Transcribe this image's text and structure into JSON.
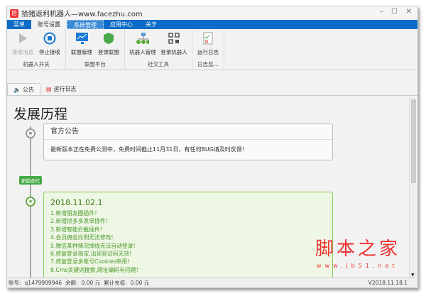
{
  "window": {
    "title": "拾猪返利机器人—www.facezhu.com",
    "minimize": "–",
    "maximize": "☐",
    "close": "✕"
  },
  "menu": [
    "菜单",
    "账号设置",
    "系统管理",
    "应用中心",
    "关于"
  ],
  "ribbon": {
    "groups": [
      {
        "label": "机器人开关",
        "buttons": [
          "接收消息",
          "停止接收"
        ]
      },
      {
        "label": "联盟平台",
        "buttons": [
          "联盟管理",
          "登录联盟"
        ]
      },
      {
        "label": "社交工具",
        "buttons": [
          "机器人管理",
          "登录机器人"
        ]
      },
      {
        "label": "日志监...",
        "buttons": [
          "运行日志"
        ]
      }
    ]
  },
  "tabs": [
    "公告",
    "运行日志"
  ],
  "page_title": "发展历程",
  "notice": {
    "title": "官方公告",
    "body": "最新版本正在免费公测中，免费时间截止11月31日，有任何BUG请及时反馈！"
  },
  "badge": "新版迭代",
  "release": {
    "version": "2018.11.02.1",
    "items": [
      "1.新增朋友圈插件！",
      "2.新增拼多多发单插件！",
      "3.新增智能拦截插件！",
      "4.会员佣金比例无法修改!",
      "5.微信某种情况掉线无法自动登录!",
      "6.修复登录淘宝,出现验证码无效!",
      "7.修复登录多账号Cookies串用!",
      "8.Cms关键词搜索,网址编码有问题!"
    ]
  },
  "status": {
    "account_label": "账号:",
    "account": "q1479909946",
    "balance_label": "余额:",
    "balance": "0.00 元",
    "recharge_label": "累计充值:",
    "recharge": "0.00 元",
    "version": "V2018.11.18.1"
  },
  "watermark": {
    "text": "脚本之家",
    "url": "www.jb51.net"
  }
}
